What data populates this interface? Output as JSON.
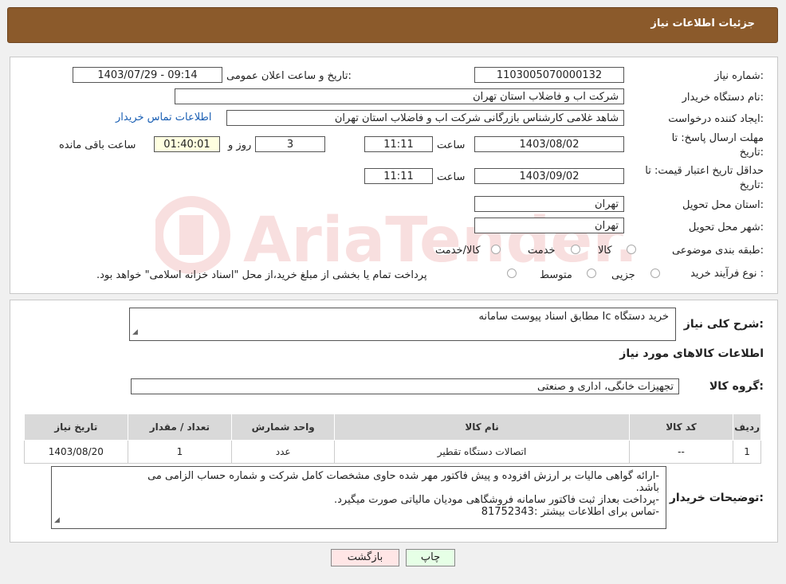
{
  "header": {
    "title": "جزئیات اطلاعات نیاز"
  },
  "form": {
    "need_number_label": "شماره نیاز:",
    "need_number": "1103005070000132",
    "announce_label": "تاریخ و ساعت اعلان عمومی:",
    "announce_value": "1403/07/29 - 09:14",
    "buyer_org_label": "نام دستگاه خریدار:",
    "buyer_org": "شرکت اب و فاضلاب استان تهران",
    "requester_label": "ایجاد کننده درخواست:",
    "requester": "شاهد غلامی کارشناس بازرگانی شرکت اب و فاضلاب استان تهران",
    "contact_link": "اطلاعات تماس خریدار",
    "deadline_label_1": "مهلت ارسال پاسخ: تا",
    "deadline_label_2": "تاریخ:",
    "deadline_date": "1403/08/02",
    "time_label": "ساعت",
    "deadline_time": "11:11",
    "days_value": "3",
    "days_label": "روز و",
    "remaining_time": "01:40:01",
    "remaining_label": "ساعت باقی مانده",
    "validity_label_1": "حداقل تاریخ اعتبار قیمت: تا",
    "validity_label_2": "تاریخ:",
    "validity_date": "1403/09/02",
    "validity_time": "11:11",
    "province_label": "استان محل تحویل:",
    "province": "تهران",
    "city_label": "شهر محل تحویل:",
    "city": "تهران",
    "category_label": "طبقه بندی موضوعی:",
    "category_options": [
      "کالا",
      "خدمت",
      "کالا/خدمت"
    ],
    "purchase_type_label": "نوع فرآیند خرید :",
    "purchase_options": [
      "جزیی",
      "متوسط"
    ],
    "purchase_note": "پرداخت تمام یا بخشی از مبلغ خرید،از محل \"اسناد خزانه اسلامی\" خواهد بود."
  },
  "details": {
    "summary_label": "شرح کلی نیاز:",
    "summary": "خرید دستگاه Ic مطابق اسناد پیوست سامانه",
    "goods_info_title": "اطلاعات کالاهای مورد نیاز",
    "goods_group_label": "گروه کالا:",
    "goods_group": "تجهیزات خانگی، اداری و صنعتی",
    "table_headers": [
      "ردیف",
      "کد کالا",
      "نام کالا",
      "واحد شمارش",
      "تعداد / مقدار",
      "تاریخ نیاز"
    ],
    "table_rows": [
      [
        "1",
        "--",
        "اتصالات دستگاه تقطیر",
        "عدد",
        "1",
        "1403/08/20"
      ]
    ],
    "buyer_notes_label": "توضیحات خریدار:",
    "buyer_notes_lines": [
      "-ارائه گواهی مالیات بر ارزش افزوده و  پیش فاکتور مهر شده حاوی مشخصات کامل شرکت و شماره حساب الزامی می",
      "باشد.",
      "-پرداخت بعداز ثبت فاکتور سامانه فروشگاهی مودیان مالیاتی صورت میگیرد.",
      "-تماس برای اطلاعات بیشتر :81752343"
    ]
  },
  "buttons": {
    "print": "چاپ",
    "back": "بازگشت"
  },
  "watermark": {
    "text": "AriaTender.neT"
  },
  "colors": {
    "header_bg": "#8b5a2b",
    "link": "#1a5fb4",
    "print_btn": "#e6ffe6",
    "back_btn": "#ffe6e6"
  }
}
